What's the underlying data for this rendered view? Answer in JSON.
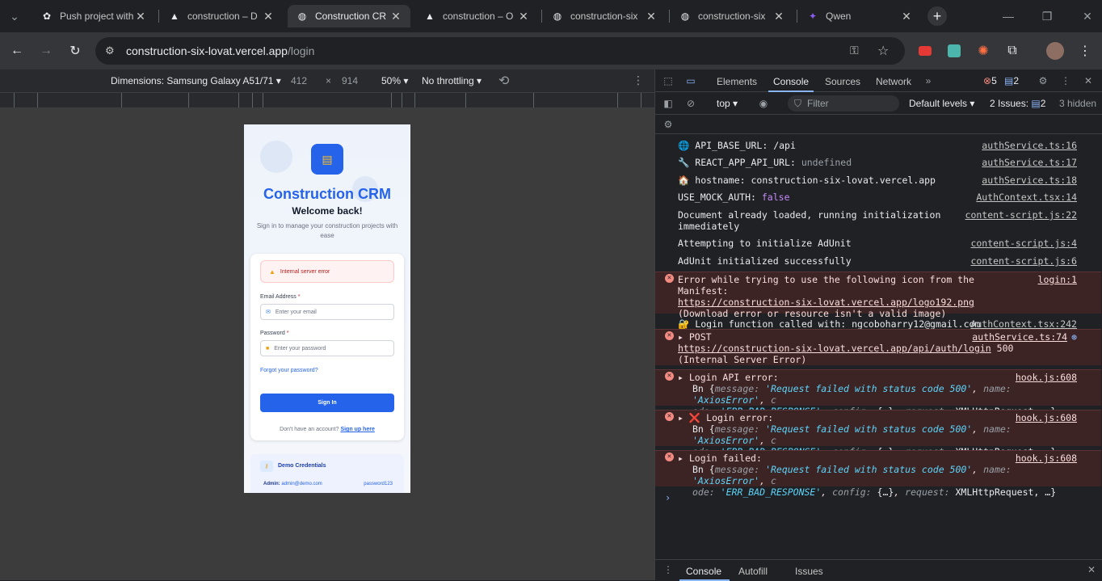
{
  "tabs": [
    {
      "label": "Push project with",
      "icon": "openai-icon"
    },
    {
      "label": "construction – D",
      "icon": "vercel-icon"
    },
    {
      "label": "Construction CR",
      "icon": "globe-icon",
      "active": true
    },
    {
      "label": "construction – O",
      "icon": "vercel-icon"
    },
    {
      "label": "construction-six",
      "icon": "globe-icon"
    },
    {
      "label": "construction-six",
      "icon": "globe-icon"
    },
    {
      "label": "Qwen",
      "icon": "qwen-icon"
    }
  ],
  "address": {
    "host": "construction-six-lovat.vercel.app",
    "path": "/login"
  },
  "device_toolbar": {
    "device": "Dimensions: Samsung Galaxy A51/71",
    "width": "412",
    "times": "×",
    "height": "914",
    "zoom": "50%",
    "throttling": "No throttling"
  },
  "page": {
    "app_title": "Construction CRM",
    "welcome": "Welcome back!",
    "subtitle": "Sign in to manage your construction projects with ease",
    "error": "Internal server error",
    "email_label": "Email Address",
    "email_placeholder": "Enter your email",
    "password_label": "Password",
    "password_placeholder": "Enter your password",
    "required_mark": "*",
    "forgot": "Forgot your password?",
    "signin": "Sign In",
    "no_account": "Don't have an account?",
    "signup": "Sign up here",
    "demo_title": "Demo Credentials",
    "demo_admin_label": "Admin:",
    "demo_admin_email": "admin@demo.com",
    "demo_admin_pass": "password123"
  },
  "devtools": {
    "tabs": [
      "Elements",
      "Console",
      "Sources",
      "Network"
    ],
    "active_tab": "Console",
    "error_count": "5",
    "message_count": "2",
    "context": "top",
    "filter_placeholder": "Filter",
    "levels": "Default levels",
    "issues_label": "2 Issues:",
    "issues_count": "2",
    "hidden": "3 hidden",
    "drawer_tabs": [
      "Console",
      "Autofill",
      "Issues"
    ]
  },
  "console": {
    "l1": {
      "emoji": "🌐",
      "text": "API_BASE_URL: /api",
      "src": "authService.ts:16"
    },
    "l2": {
      "emoji": "🔧",
      "key": "REACT_APP_API_URL:",
      "val": "undefined",
      "src": "authService.ts:17"
    },
    "l3": {
      "emoji": "🏠",
      "text": "hostname: construction-six-lovat.vercel.app",
      "src": "authService.ts:18"
    },
    "l4": {
      "key": "USE_MOCK_AUTH:",
      "val": "false",
      "src": "AuthContext.tsx:14"
    },
    "l5": {
      "text": "Document already loaded, running initialization immediately",
      "src": "content-script.js:22"
    },
    "l6": {
      "text": "Attempting to initialize AdUnit",
      "src": "content-script.js:4"
    },
    "l7": {
      "text": "AdUnit initialized successfully",
      "src": "content-script.js:6"
    },
    "e1": {
      "text": "Error while trying to use the following icon from the Manifest:",
      "url": "https://construction-six-lovat.vercel.app/logo192.png",
      "rest": "(Download error or resource isn't a valid image)",
      "src": "login:1"
    },
    "l8": {
      "emoji": "🔐",
      "text": "Login function called with: ngcoboharry12@gmail.com",
      "src": "AuthContext.tsx:242"
    },
    "e2": {
      "method": "POST",
      "url": "https://construction-six-lovat.vercel.app/api/auth/login",
      "rest": "500 (Internal Server Error)",
      "src": "authService.ts:74"
    },
    "e3": {
      "title": "Login API error:",
      "src": "hook.js:608"
    },
    "e4": {
      "emoji": "❌",
      "title": "Login error:",
      "src": "hook.js:608"
    },
    "e5": {
      "title": "Login failed:",
      "src": "hook.js:608"
    },
    "obj": {
      "cls": "Bn",
      "k1": "message:",
      "v1": "'Request failed with status code 500'",
      "k2": "name:",
      "v2": "'AxiosError'",
      "k3a": "c",
      "k3b": "ode:",
      "v3": "'ERR_BAD_RESPONSE'",
      "k4": "config:",
      "v4": "{…}",
      "k5": "request:",
      "v5": "XMLHttpRequest, …}"
    }
  }
}
